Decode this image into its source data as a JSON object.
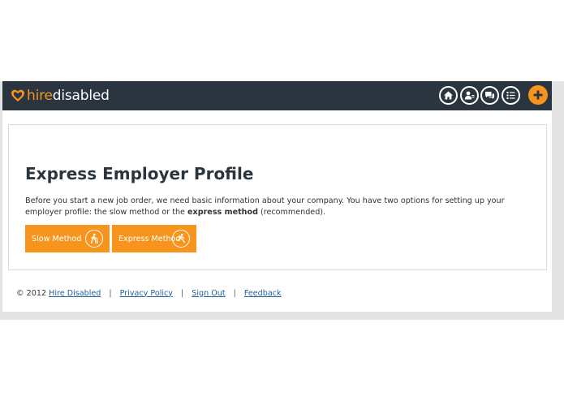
{
  "header": {
    "logo_hire": "hire",
    "logo_disabled": "disabled",
    "nav_icons": [
      "home-icon",
      "user-profile-icon",
      "messages-icon",
      "list-icon"
    ],
    "add_icon": "plus-icon",
    "bg_color": "#2a3540",
    "accent_color": "#f7941d"
  },
  "main": {
    "title": "Express Employer Profile",
    "desc_part1": "Before you start a new job order, we need basic information about your company. You have two options for setting up your employer profile: the slow method or the ",
    "desc_bold": "express method",
    "desc_part2": " (recommended).",
    "buttons": {
      "slow_label": "Slow Method",
      "express_label": "Express Method"
    }
  },
  "footer": {
    "copyright": "© 2012",
    "company_link": "Hire Disabled",
    "sep": "|",
    "privacy_link": "Privacy Policy",
    "signout_link": "Sign Out",
    "feedback_link": "Feedback"
  }
}
